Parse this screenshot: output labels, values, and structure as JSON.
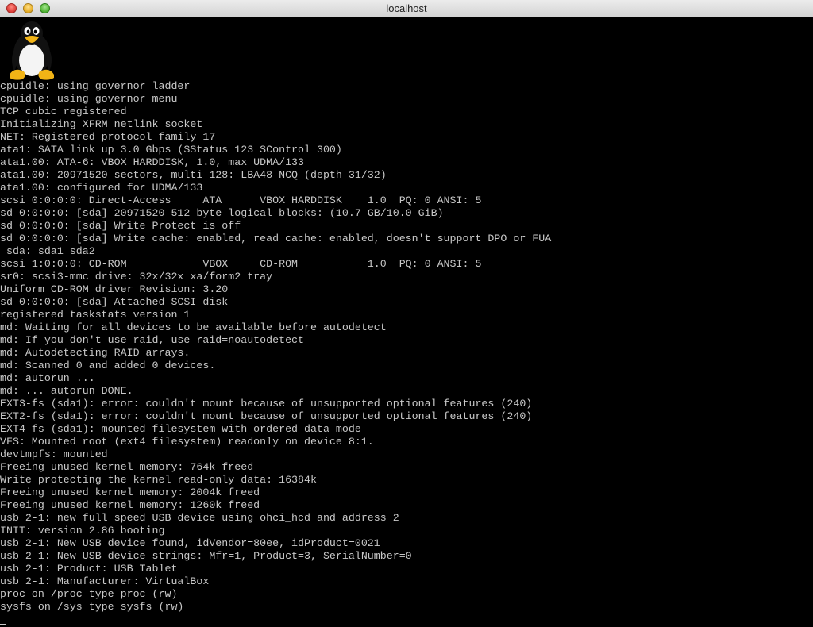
{
  "window": {
    "title": "localhost"
  },
  "console": {
    "logo_icon": "tux-penguin-icon",
    "lines": [
      "cpuidle: using governor ladder",
      "cpuidle: using governor menu",
      "TCP cubic registered",
      "Initializing XFRM netlink socket",
      "NET: Registered protocol family 17",
      "ata1: SATA link up 3.0 Gbps (SStatus 123 SControl 300)",
      "ata1.00: ATA-6: VBOX HARDDISK, 1.0, max UDMA/133",
      "ata1.00: 20971520 sectors, multi 128: LBA48 NCQ (depth 31/32)",
      "ata1.00: configured for UDMA/133",
      "scsi 0:0:0:0: Direct-Access     ATA      VBOX HARDDISK    1.0  PQ: 0 ANSI: 5",
      "sd 0:0:0:0: [sda] 20971520 512-byte logical blocks: (10.7 GB/10.0 GiB)",
      "sd 0:0:0:0: [sda] Write Protect is off",
      "sd 0:0:0:0: [sda] Write cache: enabled, read cache: enabled, doesn't support DPO or FUA",
      " sda: sda1 sda2",
      "scsi 1:0:0:0: CD-ROM            VBOX     CD-ROM           1.0  PQ: 0 ANSI: 5",
      "sr0: scsi3-mmc drive: 32x/32x xa/form2 tray",
      "Uniform CD-ROM driver Revision: 3.20",
      "sd 0:0:0:0: [sda] Attached SCSI disk",
      "registered taskstats version 1",
      "md: Waiting for all devices to be available before autodetect",
      "md: If you don't use raid, use raid=noautodetect",
      "md: Autodetecting RAID arrays.",
      "md: Scanned 0 and added 0 devices.",
      "md: autorun ...",
      "md: ... autorun DONE.",
      "EXT3-fs (sda1): error: couldn't mount because of unsupported optional features (240)",
      "EXT2-fs (sda1): error: couldn't mount because of unsupported optional features (240)",
      "EXT4-fs (sda1): mounted filesystem with ordered data mode",
      "VFS: Mounted root (ext4 filesystem) readonly on device 8:1.",
      "devtmpfs: mounted",
      "Freeing unused kernel memory: 764k freed",
      "Write protecting the kernel read-only data: 16384k",
      "Freeing unused kernel memory: 2004k freed",
      "Freeing unused kernel memory: 1260k freed",
      "usb 2-1: new full speed USB device using ohci_hcd and address 2",
      "INIT: version 2.86 booting",
      "usb 2-1: New USB device found, idVendor=80ee, idProduct=0021",
      "usb 2-1: New USB device strings: Mfr=1, Product=3, SerialNumber=0",
      "usb 2-1: Product: USB Tablet",
      "usb 2-1: Manufacturer: VirtualBox",
      "proc on /proc type proc (rw)",
      "sysfs on /sys type sysfs (rw)"
    ]
  }
}
